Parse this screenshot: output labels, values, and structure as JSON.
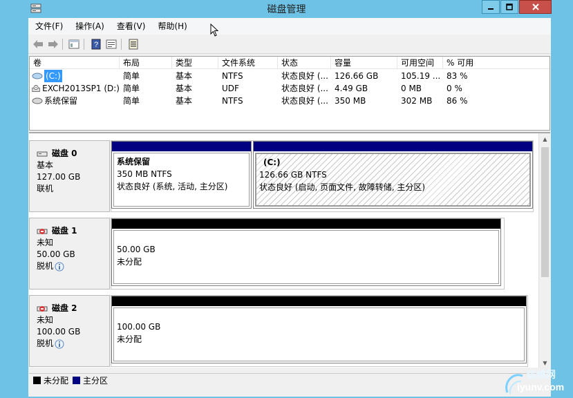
{
  "window": {
    "title": "磁盘管理",
    "accent": "#6ec2e6"
  },
  "menu": [
    "文件(F)",
    "操作(A)",
    "查看(V)",
    "帮助(H)"
  ],
  "toolbar": {
    "icons": [
      "back-arrow-icon",
      "forward-arrow-icon",
      "console-tree-icon",
      "help-icon",
      "properties-icon",
      "disk-settings-icon"
    ]
  },
  "volume_table": {
    "columns": [
      "卷",
      "布局",
      "类型",
      "文件系统",
      "状态",
      "容量",
      "可用空间",
      "% 可用"
    ],
    "rows": [
      {
        "name": "(C:)",
        "layout": "简单",
        "type": "基本",
        "fs": "NTFS",
        "status": "状态良好 (...",
        "capacity": "126.66 GB",
        "free": "105.19 ...",
        "pct": "83 %"
      },
      {
        "name": "EXCH2013SP1 (D:)",
        "layout": "简单",
        "type": "基本",
        "fs": "UDF",
        "status": "状态良好 (...",
        "capacity": "4.49 GB",
        "free": "0 MB",
        "pct": "0 %"
      },
      {
        "name": "系统保留",
        "layout": "简单",
        "type": "基本",
        "fs": "NTFS",
        "status": "状态良好 (...",
        "capacity": "350 MB",
        "free": "302 MB",
        "pct": "86 %"
      }
    ]
  },
  "disks": [
    {
      "name": "磁盘 0",
      "kind": "基本",
      "size": "127.00 GB",
      "state": "联机",
      "partitions": [
        {
          "name": "系统保留",
          "size": "350 MB NTFS",
          "status": "状态良好 (系统, 活动, 主分区)"
        },
        {
          "name": "(C:)",
          "size": "126.66 GB NTFS",
          "status": "状态良好 (启动, 页面文件, 故障转储, 主分区)"
        }
      ]
    },
    {
      "name": "磁盘 1",
      "kind": "未知",
      "size": "50.00 GB",
      "state": "脱机",
      "partitions": [
        {
          "size": "50.00 GB",
          "status": "未分配"
        }
      ]
    },
    {
      "name": "磁盘 2",
      "kind": "未知",
      "size": "100.00 GB",
      "state": "脱机",
      "partitions": [
        {
          "size": "100.00 GB",
          "status": "未分配"
        }
      ]
    }
  ],
  "legend": [
    {
      "label": "未分配",
      "color": "#000000"
    },
    {
      "label": "主分区",
      "color": "#000080"
    }
  ],
  "watermark": {
    "text": "运维网",
    "url_text": "iyunv.com"
  }
}
